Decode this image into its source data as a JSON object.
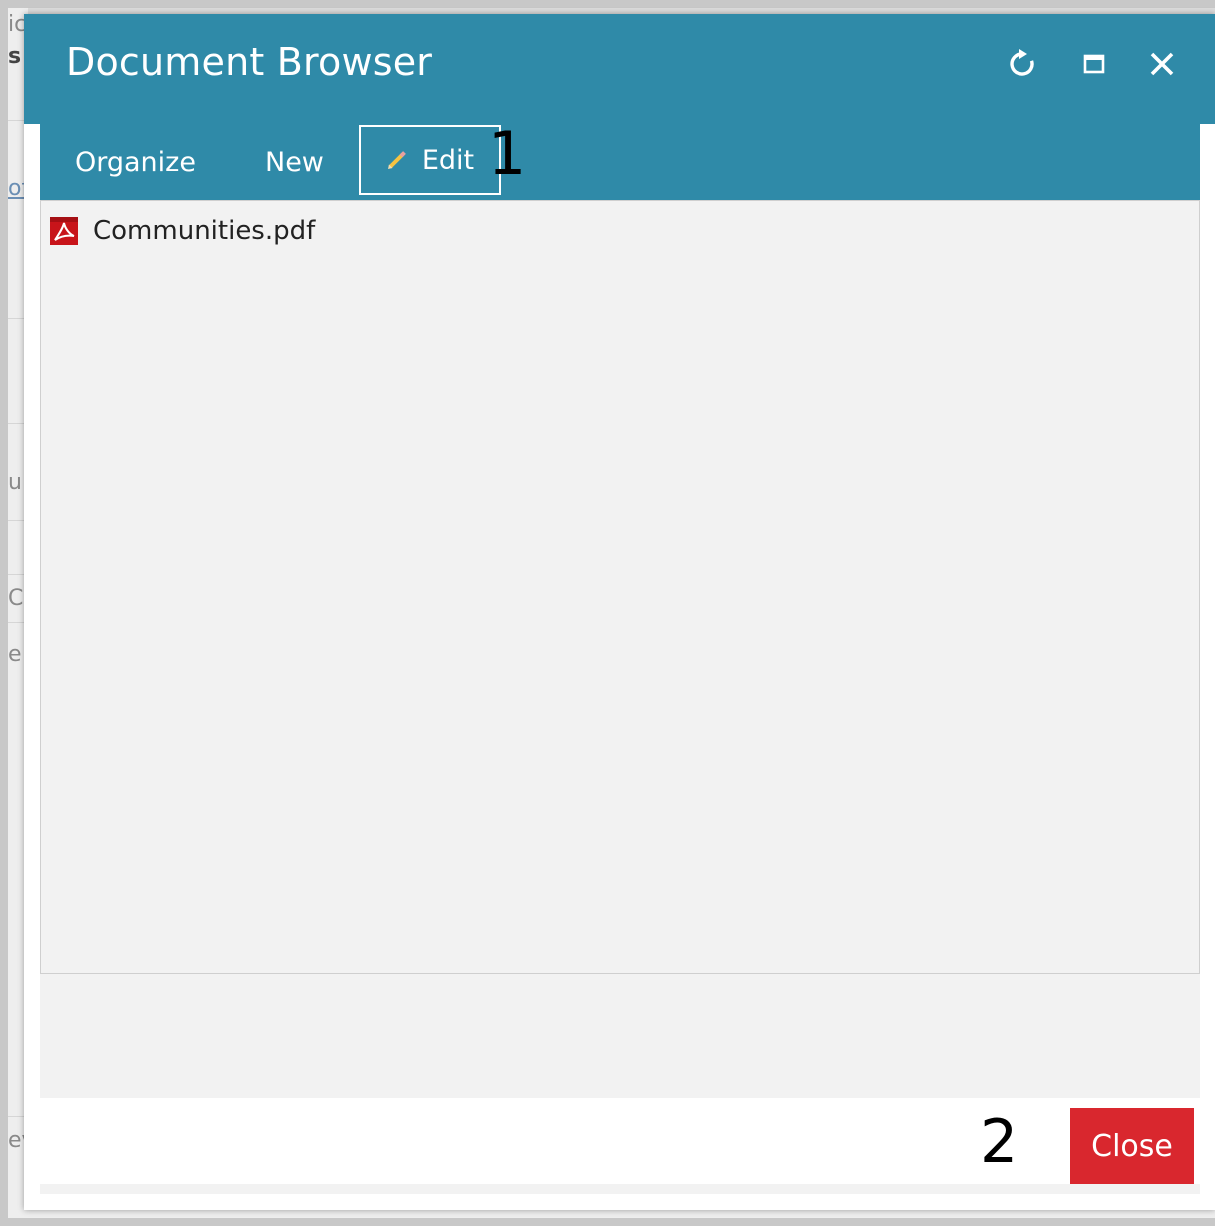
{
  "background": {
    "fragments": [
      "ic",
      "s",
      "of",
      "ul",
      "C",
      "e",
      "ev"
    ]
  },
  "dialog": {
    "title": "Document Browser",
    "window_controls": [
      "refresh-icon",
      "maximize-icon",
      "close-icon"
    ]
  },
  "toolbar": {
    "tabs": [
      {
        "label": "Organize"
      },
      {
        "label": "New"
      },
      {
        "label": "Edit",
        "icon": "pencil-icon"
      }
    ]
  },
  "annotations": {
    "one": "1",
    "two": "2"
  },
  "files": [
    {
      "name": "Communities.pdf",
      "icon": "pdf-icon"
    }
  ],
  "footer": {
    "close_label": "Close"
  },
  "colors": {
    "header": "#2f8aa8",
    "close_button": "#d9272e",
    "list_bg": "#f2f2f2"
  }
}
